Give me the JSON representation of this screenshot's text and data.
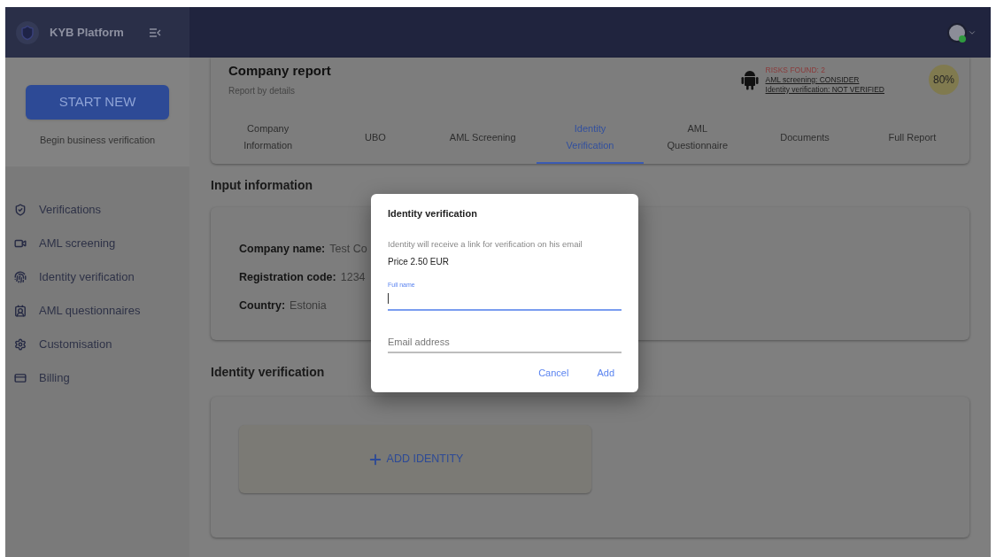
{
  "app": {
    "title": "KYB Platform"
  },
  "sidebar": {
    "start_button": "START NEW",
    "start_caption": "Begin business verification",
    "items": [
      {
        "label": "Verifications"
      },
      {
        "label": "AML screening"
      },
      {
        "label": "Identity verification"
      },
      {
        "label": "AML questionnaires"
      },
      {
        "label": "Customisation"
      },
      {
        "label": "Billing"
      }
    ]
  },
  "report": {
    "title": "Company report",
    "subtitle": "Report by details",
    "risks": {
      "heading": "RISKS FOUND: 2",
      "links": [
        "AML screening: CONSIDER",
        "Identity verification: NOT VERIFIED"
      ]
    },
    "score": "80%",
    "tabs": [
      {
        "label": "Company Information",
        "selected": false
      },
      {
        "label": "UBO",
        "selected": false
      },
      {
        "label": "AML Screening",
        "selected": false
      },
      {
        "label": "Identity Verification",
        "selected": true
      },
      {
        "label": "AML Questionnaire",
        "selected": false
      },
      {
        "label": "Documents",
        "selected": false
      },
      {
        "label": "Full Report",
        "selected": false
      }
    ]
  },
  "input_section": {
    "heading": "Input information",
    "fields": [
      {
        "label": "Company name:",
        "value": "Test Co"
      },
      {
        "label": "Registration code:",
        "value": "1234"
      },
      {
        "label": "Country:",
        "value": "Estonia"
      }
    ]
  },
  "identity_section": {
    "heading": "Identity verification",
    "add_button": "ADD IDENTITY"
  },
  "dialog": {
    "title": "Identity verification",
    "message": "Identity will receive a link for verification on his email",
    "price": "Price 2.50 EUR",
    "fields": [
      {
        "label": "Full name",
        "focused": true
      },
      {
        "label": "Email address",
        "focused": false
      }
    ],
    "buttons": [
      "Cancel",
      "Add"
    ]
  }
}
